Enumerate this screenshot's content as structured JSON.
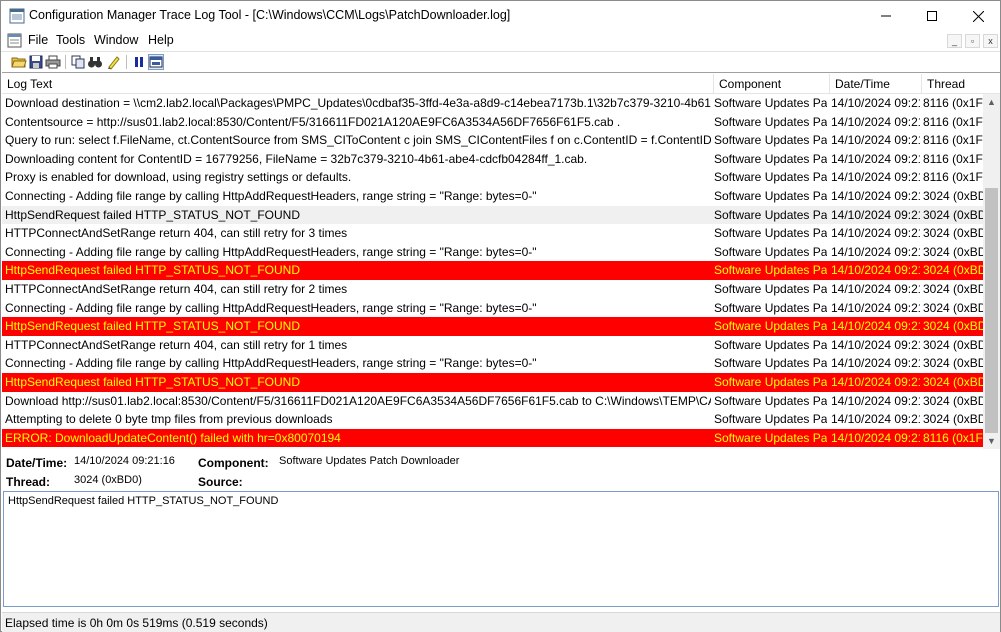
{
  "window": {
    "title": "Configuration Manager Trace Log Tool - [C:\\Windows\\CCM\\Logs\\PatchDownloader.log]",
    "minimize_glyph": "—",
    "maximize_glyph": "☐",
    "close_glyph": "✕"
  },
  "menu": {
    "items": [
      "File",
      "Tools",
      "Window",
      "Help"
    ],
    "mdi_minimize": "_",
    "mdi_restore": "▫",
    "mdi_close": "x"
  },
  "toolbar": {
    "icons": [
      "open-icon",
      "save-icon",
      "print-icon",
      "copy-icon",
      "find-icon",
      "highlight-icon",
      "pause-icon",
      "error-lookup-icon"
    ]
  },
  "grid": {
    "columns": [
      "Log Text",
      "Component",
      "Date/Time",
      "Thread"
    ],
    "rows": [
      {
        "text": "Download destination = \\\\cm2.lab2.local\\Packages\\PMPC_Updates\\0cdbaf35-3ffd-4e3a-a8d9-c14ebea7173b.1\\32b7c379-3210-4b61-a...",
        "component": "Software Updates Patc",
        "datetime": "14/10/2024 09:21",
        "thread": "8116 (0x1FI",
        "style": "normal"
      },
      {
        "text": "Contentsource = http://sus01.lab2.local:8530/Content/F5/316611FD021A120AE9FC6A3534A56DF7656F61F5.cab .",
        "component": "Software Updates Patc",
        "datetime": "14/10/2024 09:21",
        "thread": "8116 (0x1FI",
        "style": "normal"
      },
      {
        "text": "Query to run: select f.FileName, ct.ContentSource from SMS_CIToContent c join SMS_CIContentFiles f on c.ContentID = f.ContentID join S...",
        "component": "Software Updates Patc",
        "datetime": "14/10/2024 09:21",
        "thread": "8116 (0x1FI",
        "style": "normal"
      },
      {
        "text": "Downloading content for ContentID = 16779256,  FileName = 32b7c379-3210-4b61-abe4-cdcfb04284ff_1.cab.",
        "component": "Software Updates Patc",
        "datetime": "14/10/2024 09:21",
        "thread": "8116 (0x1FI",
        "style": "normal"
      },
      {
        "text": "Proxy is enabled for download, using registry settings or defaults.",
        "component": "Software Updates Patc",
        "datetime": "14/10/2024 09:21",
        "thread": "8116 (0x1FI",
        "style": "normal"
      },
      {
        "text": "Connecting - Adding file range by calling HttpAddRequestHeaders, range string = \"Range: bytes=0-\"",
        "component": "Software Updates Patc",
        "datetime": "14/10/2024 09:21",
        "thread": "3024 (0xBD",
        "style": "normal"
      },
      {
        "text": "HttpSendRequest failed HTTP_STATUS_NOT_FOUND",
        "component": "Software Updates Patc",
        "datetime": "14/10/2024 09:21",
        "thread": "3024 (0xBD",
        "style": "selected"
      },
      {
        "text": "HTTPConnectAndSetRange return 404, can still retry for 3 times",
        "component": "Software Updates Patc",
        "datetime": "14/10/2024 09:21",
        "thread": "3024 (0xBD",
        "style": "normal"
      },
      {
        "text": "Connecting - Adding file range by calling HttpAddRequestHeaders, range string = \"Range: bytes=0-\"",
        "component": "Software Updates Patc",
        "datetime": "14/10/2024 09:21",
        "thread": "3024 (0xBD",
        "style": "normal"
      },
      {
        "text": "HttpSendRequest failed HTTP_STATUS_NOT_FOUND",
        "component": "Software Updates Patc",
        "datetime": "14/10/2024 09:21",
        "thread": "3024 (0xBD",
        "style": "error"
      },
      {
        "text": "HTTPConnectAndSetRange return 404, can still retry for 2 times",
        "component": "Software Updates Patc",
        "datetime": "14/10/2024 09:21",
        "thread": "3024 (0xBD",
        "style": "normal"
      },
      {
        "text": "Connecting - Adding file range by calling HttpAddRequestHeaders, range string = \"Range: bytes=0-\"",
        "component": "Software Updates Patc",
        "datetime": "14/10/2024 09:21",
        "thread": "3024 (0xBD",
        "style": "normal"
      },
      {
        "text": "HttpSendRequest failed HTTP_STATUS_NOT_FOUND",
        "component": "Software Updates Patc",
        "datetime": "14/10/2024 09:21",
        "thread": "3024 (0xBD",
        "style": "error"
      },
      {
        "text": "HTTPConnectAndSetRange return 404, can still retry for 1 times",
        "component": "Software Updates Patc",
        "datetime": "14/10/2024 09:21",
        "thread": "3024 (0xBD",
        "style": "normal"
      },
      {
        "text": "Connecting - Adding file range by calling HttpAddRequestHeaders, range string = \"Range: bytes=0-\"",
        "component": "Software Updates Patc",
        "datetime": "14/10/2024 09:21",
        "thread": "3024 (0xBD",
        "style": "normal"
      },
      {
        "text": "HttpSendRequest failed HTTP_STATUS_NOT_FOUND",
        "component": "Software Updates Patc",
        "datetime": "14/10/2024 09:21",
        "thread": "3024 (0xBD",
        "style": "error"
      },
      {
        "text": "Download http://sus01.lab2.local:8530/Content/F5/316611FD021A120AE9FC6A3534A56DF7656F61F5.cab to C:\\Windows\\TEMP\\CAB6D6...",
        "component": "Software Updates Patc",
        "datetime": "14/10/2024 09:21",
        "thread": "3024 (0xBD",
        "style": "normal"
      },
      {
        "text": "Attempting to delete 0 byte tmp files from previous downloads",
        "component": "Software Updates Patc",
        "datetime": "14/10/2024 09:21",
        "thread": "3024 (0xBD",
        "style": "normal"
      },
      {
        "text": "ERROR: DownloadUpdateContent() failed with hr=0x80070194",
        "component": "Software Updates Patc",
        "datetime": "14/10/2024 09:21",
        "thread": "8116 (0x1FI",
        "style": "error"
      }
    ],
    "scroll_up": "▲",
    "scroll_down": "▼"
  },
  "details": {
    "datetime_label": "Date/Time:",
    "datetime_value": "14/10/2024 09:21:16",
    "component_label": "Component:",
    "component_value": "Software Updates Patch Downloader",
    "thread_label": "Thread:",
    "thread_value": "3024 (0xBD0)",
    "source_label": "Source:",
    "source_value": "",
    "message": "HttpSendRequest failed HTTP_STATUS_NOT_FOUND"
  },
  "status": {
    "text": "Elapsed time is 0h 0m 0s 519ms (0.519 seconds)"
  },
  "colors": {
    "error_bg": "#ff0000",
    "error_fg": "#ffff00"
  }
}
